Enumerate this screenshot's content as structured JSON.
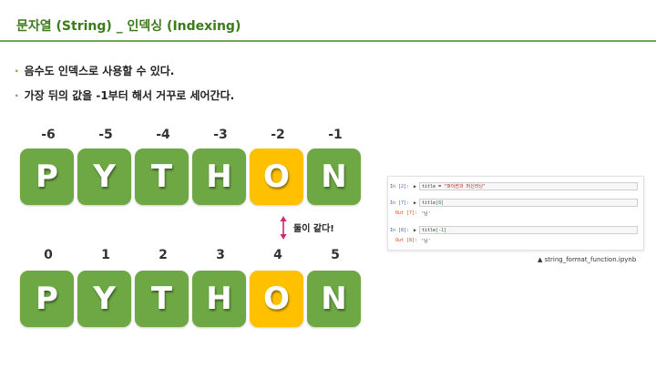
{
  "header": {
    "title": "문자열 (String) _ 인덱싱 (Indexing)"
  },
  "bullets": [
    {
      "marker": "·",
      "text": "음수도 인덱스로 사용할 수 있다."
    },
    {
      "marker": "·",
      "text": "가장 뒤의 값을 -1부터 해서 거꾸로 세어간다."
    }
  ],
  "top_row": {
    "indices": [
      "-6",
      "-5",
      "-4",
      "-3",
      "-2",
      "-1"
    ],
    "letters": [
      "P",
      "Y",
      "T",
      "H",
      "O",
      "N"
    ]
  },
  "bottom_row": {
    "indices": [
      "0",
      "1",
      "2",
      "3",
      "4",
      "5"
    ],
    "letters": [
      "P",
      "Y",
      "T",
      "H",
      "O",
      "N"
    ]
  },
  "highlight_index": 4,
  "equal_label": "둘이 같다!",
  "notebook": {
    "cells": [
      {
        "in_prompt": "In [2]:",
        "code_var": "title",
        "code_op": " = ",
        "code_str": "\"파이썬과 머신러닝\"",
        "code_idx": "",
        "out_prompt": "",
        "out": ""
      },
      {
        "in_prompt": "In [7]:",
        "code_var": "title",
        "code_op": "",
        "code_str": "",
        "code_idx": "[8]",
        "out_prompt": "Out [7]:",
        "out": "'닝'"
      },
      {
        "in_prompt": "In [8]:",
        "code_var": "title",
        "code_op": "",
        "code_str": "",
        "code_idx": "[-1]",
        "out_prompt": "Out [8]:",
        "out": "'닝'"
      }
    ],
    "run_icon": "▶"
  },
  "caption": "▲ string_format_function.ipynb",
  "colors": {
    "green": "#6da844",
    "highlight": "#ffc000",
    "title": "#3c7a1c",
    "arrow": "#d6246e"
  }
}
